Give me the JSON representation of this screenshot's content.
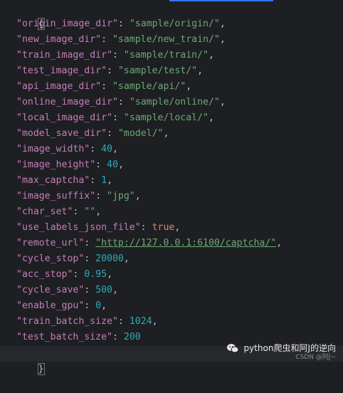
{
  "editor": {
    "open_brace": "{",
    "close_brace": "}",
    "lines": [
      {
        "key": "\"origin_image_dir\"",
        "sep": ": ",
        "value": "\"sample/origin/\"",
        "vtype": "str",
        "comma": ","
      },
      {
        "key": "\"new_image_dir\"",
        "sep": ": ",
        "value": "\"sample/new_train/\"",
        "vtype": "str",
        "comma": ","
      },
      {
        "key": "\"train_image_dir\"",
        "sep": ": ",
        "value": "\"sample/train/\"",
        "vtype": "str",
        "comma": ","
      },
      {
        "key": "\"test_image_dir\"",
        "sep": ": ",
        "value": "\"sample/test/\"",
        "vtype": "str",
        "comma": ","
      },
      {
        "key": "\"api_image_dir\"",
        "sep": ": ",
        "value": "\"sample/api/\"",
        "vtype": "str",
        "comma": ","
      },
      {
        "key": "\"online_image_dir\"",
        "sep": ": ",
        "value": "\"sample/online/\"",
        "vtype": "str",
        "comma": ","
      },
      {
        "key": "\"local_image_dir\"",
        "sep": ": ",
        "value": "\"sample/local/\"",
        "vtype": "str",
        "comma": ","
      },
      {
        "key": "\"model_save_dir\"",
        "sep": ": ",
        "value": "\"model/\"",
        "vtype": "str",
        "comma": ","
      },
      {
        "key": "\"image_width\"",
        "sep": ": ",
        "value": "40",
        "vtype": "num",
        "comma": ","
      },
      {
        "key": "\"image_height\"",
        "sep": ": ",
        "value": "40",
        "vtype": "num",
        "comma": ","
      },
      {
        "key": "\"max_captcha\"",
        "sep": ": ",
        "value": "1",
        "vtype": "num",
        "comma": ","
      },
      {
        "key": "\"image_suffix\"",
        "sep": ": ",
        "value": "\"jpg\"",
        "vtype": "str",
        "comma": ","
      },
      {
        "key": "\"char_set\"",
        "sep": ": ",
        "value": "\"\"",
        "vtype": "str",
        "comma": ","
      },
      {
        "key": "\"use_labels_json_file\"",
        "sep": ": ",
        "value": "true",
        "vtype": "kw",
        "comma": ","
      },
      {
        "key": "\"remote_url\"",
        "sep": ": ",
        "value": "\"http://127.0.0.1:6100/captcha/\"",
        "vtype": "url",
        "comma": ","
      },
      {
        "key": "\"cycle_stop\"",
        "sep": ": ",
        "value": "20000",
        "vtype": "num",
        "comma": ","
      },
      {
        "key": "\"acc_stop\"",
        "sep": ": ",
        "value": "0.95",
        "vtype": "num",
        "comma": ","
      },
      {
        "key": "\"cycle_save\"",
        "sep": ": ",
        "value": "500",
        "vtype": "num",
        "comma": ","
      },
      {
        "key": "\"enable_gpu\"",
        "sep": ": ",
        "value": "0",
        "vtype": "num",
        "comma": ","
      },
      {
        "key": "\"train_batch_size\"",
        "sep": ": ",
        "value": "1024",
        "vtype": "num",
        "comma": ","
      },
      {
        "key": "\"test_batch_size\"",
        "sep": ": ",
        "value": "200",
        "vtype": "num",
        "comma": ""
      }
    ]
  },
  "watermark": {
    "text": "python爬虫和阿J的逆向",
    "sub": "CSDN @阿J~",
    "icon": "wechat-icon"
  },
  "colors": {
    "background": "#1e1f22",
    "key": "#c77dbb",
    "string": "#6aab73",
    "number": "#2aacb8",
    "keyword": "#cf8e6d",
    "punctuation": "#bcbec4",
    "accent": "#3574f0"
  }
}
